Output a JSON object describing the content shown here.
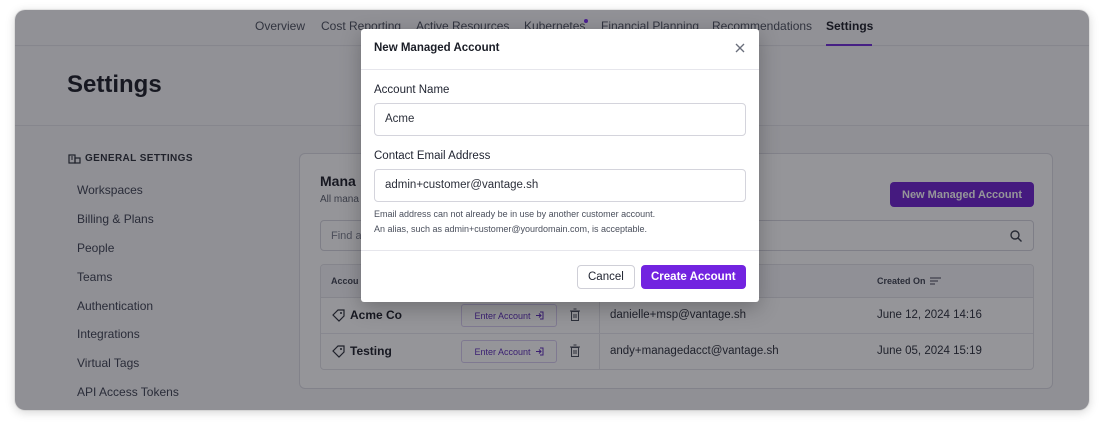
{
  "nav": {
    "tabs": [
      "Overview",
      "Cost Reporting",
      "Active Resources",
      "Kubernetes",
      "Financial Planning",
      "Recommendations",
      "Settings"
    ],
    "active": "Settings",
    "accent": "#6f2bd9"
  },
  "page": {
    "title": "Settings"
  },
  "sidebar": {
    "section_title": "GENERAL SETTINGS",
    "items": [
      "Workspaces",
      "Billing & Plans",
      "People",
      "Teams",
      "Authentication",
      "Integrations",
      "Virtual Tags",
      "API Access Tokens"
    ]
  },
  "panel": {
    "title": "Mana",
    "subtitle": "All mana",
    "new_button": "New Managed Account",
    "search_placeholder": "Find a",
    "columns": [
      "Accou",
      "Created On"
    ],
    "rows": [
      {
        "name": "Acme Co",
        "enter_label": "Enter Account",
        "email": "danielle+msp@vantage.sh",
        "created": "June 12, 2024 14:16"
      },
      {
        "name": "Testing",
        "enter_label": "Enter Account",
        "email": "andy+managedacct@vantage.sh",
        "created": "June 05, 2024 15:19"
      }
    ]
  },
  "modal": {
    "title": "New Managed Account",
    "account_name_label": "Account Name",
    "account_name_value": "Acme",
    "email_label": "Contact Email Address",
    "email_value": "admin+customer@vantage.sh",
    "hint_line1": "Email address can not already be in use by another customer account.",
    "hint_line2": "An alias, such as admin+customer@yourdomain.com, is acceptable.",
    "cancel_label": "Cancel",
    "create_label": "Create Account",
    "primary_color": "#7223e0"
  }
}
